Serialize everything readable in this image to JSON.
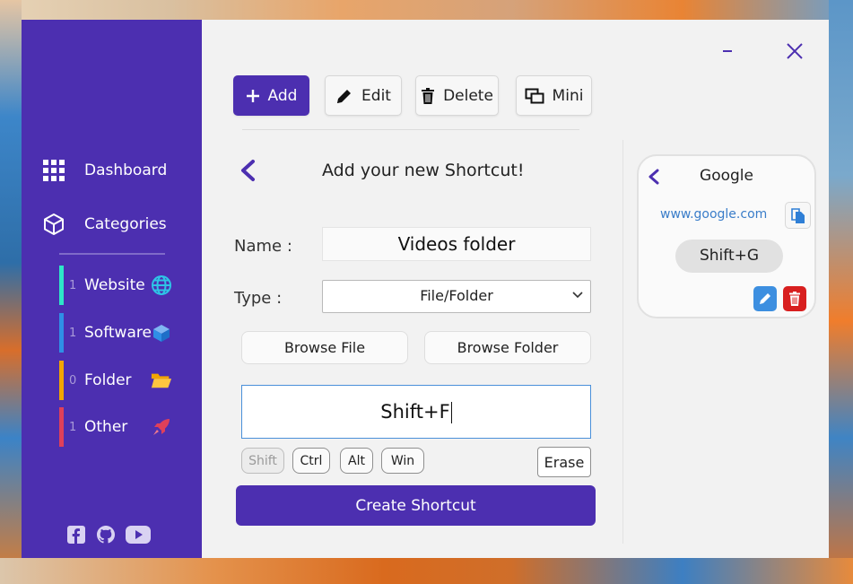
{
  "window_controls": {
    "minimize": "–",
    "close": "✕"
  },
  "sidebar": {
    "nav": [
      {
        "label": "Dashboard",
        "icon": "grid-icon"
      },
      {
        "label": "Categories",
        "icon": "cube-icon"
      }
    ],
    "categories": [
      {
        "count": "1",
        "label": "Website",
        "color": "#2ee6c8",
        "icon": "globe-icon"
      },
      {
        "count": "1",
        "label": "Software",
        "color": "#2f8fe6",
        "icon": "package-icon"
      },
      {
        "count": "0",
        "label": "Folder",
        "color": "#f2a500",
        "icon": "folder-open-icon"
      },
      {
        "count": "1",
        "label": "Other",
        "color": "#e0405a",
        "icon": "rocket-icon"
      }
    ],
    "social": [
      "facebook-icon",
      "github-icon",
      "youtube-icon"
    ]
  },
  "toolbar": {
    "add_label": "Add",
    "edit_label": "Edit",
    "delete_label": "Delete",
    "mini_label": "Mini"
  },
  "form": {
    "title": "Add your new Shortcut!",
    "name_label": "Name :",
    "name_value": "Videos folder",
    "type_label": "Type :",
    "type_value": "File/Folder",
    "browse_file_label": "Browse File",
    "browse_folder_label": "Browse Folder",
    "hotkey_value": "Shift+F",
    "modifiers": [
      "Shift",
      "Ctrl",
      "Alt",
      "Win"
    ],
    "active_modifier": "Shift",
    "erase_label": "Erase",
    "create_label": "Create Shortcut"
  },
  "preview_card": {
    "title": "Google",
    "url": "www.google.com",
    "keys": "Shift+G"
  },
  "colors": {
    "accent": "#4c2fb0",
    "link": "#3a7dc9",
    "edit": "#3d8fe0",
    "delete": "#d81f1f"
  }
}
